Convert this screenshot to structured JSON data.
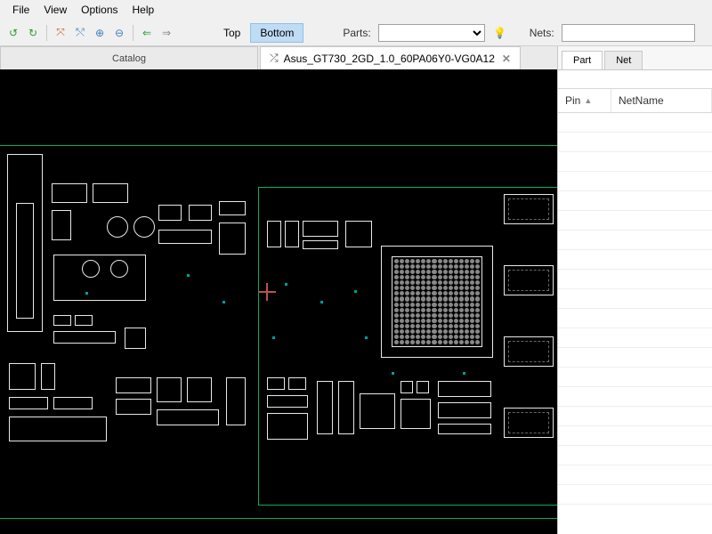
{
  "menu": {
    "file": "File",
    "view": "View",
    "options": "Options",
    "help": "Help"
  },
  "toolbar": {
    "back_icon": "↺",
    "forward_icon": "↻",
    "zoom_fit_icon": "⤧",
    "zoom_win_icon": "⤲",
    "zoom_in_icon": "⊕",
    "zoom_out_icon": "⊖",
    "arrow_left": "⇐",
    "arrow_right": "⇒",
    "layer_top": "Top",
    "layer_bottom": "Bottom",
    "parts_label": "Parts:",
    "parts_value": "",
    "nets_label": "Nets:",
    "nets_value": "",
    "bulb": "💡"
  },
  "tabs": {
    "catalog": "Catalog",
    "active": "Asus_GT730_2GD_1.0_60PA06Y0-VG0A12",
    "shuffle_icon": "✕",
    "close_icon": "✕"
  },
  "right": {
    "tab_part": "Part",
    "tab_net": "Net",
    "col_pin": "Pin",
    "col_netname": "NetName"
  }
}
